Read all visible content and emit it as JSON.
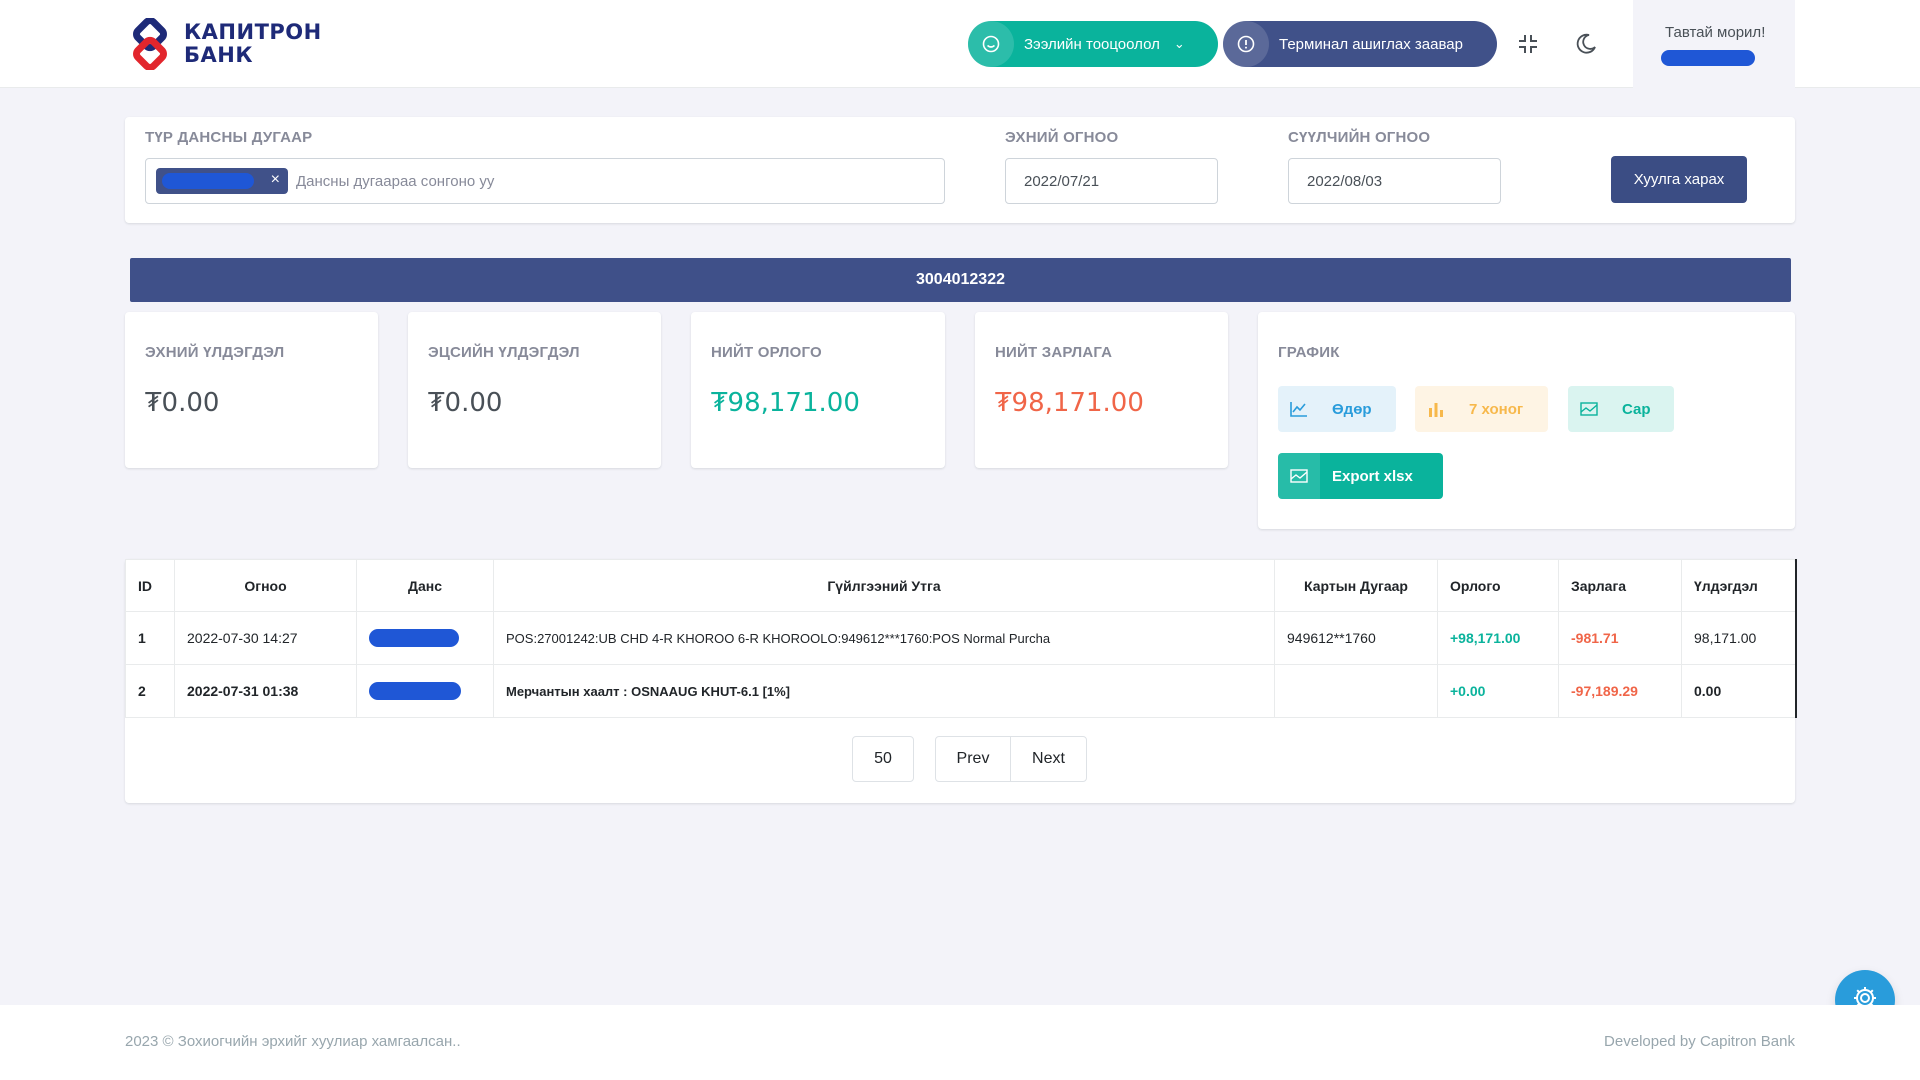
{
  "header": {
    "logo_line1": "КАПИТРОН",
    "logo_line2": "БАНК",
    "calc_label": "Зээлийн тооцоолол",
    "guide_label": "Терминал ашиглах заавар",
    "welcome": "Тавтай морил!"
  },
  "filter": {
    "account_label": "ТҮР ДАНСНЫ ДУГААР",
    "account_placeholder": "Дансны дугаараа сонгоно уу",
    "start_label": "ЭХНИЙ ОГНОО",
    "start_value": "2022/07/21",
    "end_label": "СҮҮЛЧИЙН ОГНОО",
    "end_value": "2022/08/03",
    "view_button": "Хуулга харах"
  },
  "account_number": "3004012322",
  "stats": {
    "opening_label": "ЭХНИЙ ҮЛДЭГДЭЛ",
    "opening_value": "₮0.00",
    "closing_label": "ЭЦСИЙН ҮЛДЭГДЭЛ",
    "closing_value": "₮0.00",
    "income_label": "НИЙТ ОРЛОГО",
    "income_value": "₮98,171.00",
    "expense_label": "НИЙТ ЗАРЛАГА",
    "expense_value": "₮98,171.00"
  },
  "graph": {
    "title": "ГРАФИК",
    "day": "Өдөр",
    "week": "7 хоног",
    "month": "Сар",
    "export": "Export xlsx"
  },
  "table": {
    "headers": [
      "ID",
      "Огноо",
      "Данс",
      "Гүйлгээний Утга",
      "Картын Дугаар",
      "Орлого",
      "Зарлага",
      "Үлдэгдэл"
    ],
    "rows": [
      {
        "id": "1",
        "date": "2022-07-30 14:27",
        "desc": "POS:27001242:UB CHD 4-R KHOROO 6-R KHOROOLO:949612***1760:POS Normal Purcha",
        "card": "949612**1760",
        "income": "+98,171.00",
        "expense": "-981.71",
        "balance": "98,171.00"
      },
      {
        "id": "2",
        "date": "2022-07-31 01:38",
        "desc": "Мерчантын хаалт : OSNAAUG KHUT-6.1 [1%]",
        "card": "",
        "income": "+0.00",
        "expense": "-97,189.29",
        "balance": "0.00"
      }
    ]
  },
  "pager": {
    "page_size": "50",
    "prev": "Prev",
    "next": "Next"
  },
  "footer": {
    "left": "2023 © Зохиогчийн эрхийг хуулиар хамгаалсан..",
    "right": "Developed by Capitron Bank"
  },
  "colors": {
    "primary": "#405189",
    "success": "#0ab39c",
    "danger": "#f06548",
    "info": "#299cdb",
    "warning": "#f7b84b"
  }
}
